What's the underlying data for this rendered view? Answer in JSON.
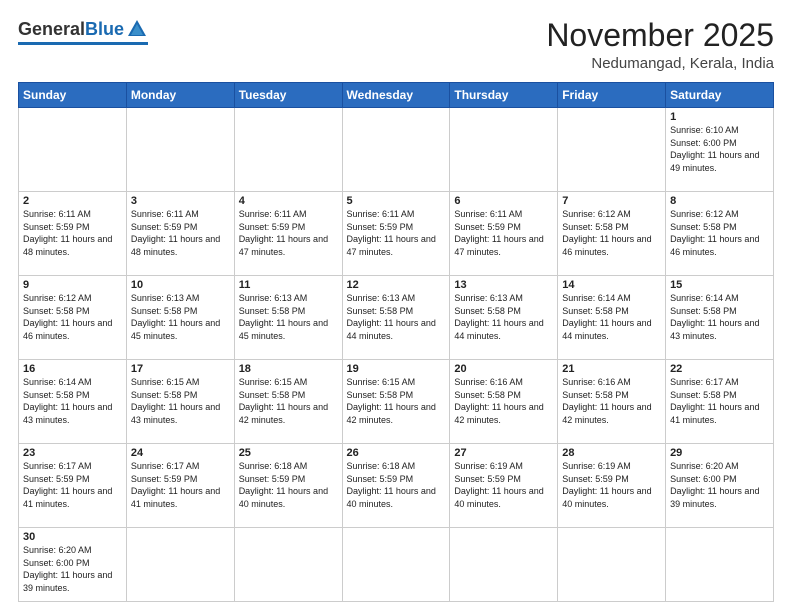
{
  "header": {
    "logo_general": "General",
    "logo_blue": "Blue",
    "month_title": "November 2025",
    "location": "Nedumangad, Kerala, India"
  },
  "days_of_week": [
    "Sunday",
    "Monday",
    "Tuesday",
    "Wednesday",
    "Thursday",
    "Friday",
    "Saturday"
  ],
  "weeks": [
    [
      {
        "day": "",
        "sunrise": "",
        "sunset": "",
        "daylight": "",
        "empty": true
      },
      {
        "day": "",
        "sunrise": "",
        "sunset": "",
        "daylight": "",
        "empty": true
      },
      {
        "day": "",
        "sunrise": "",
        "sunset": "",
        "daylight": "",
        "empty": true
      },
      {
        "day": "",
        "sunrise": "",
        "sunset": "",
        "daylight": "",
        "empty": true
      },
      {
        "day": "",
        "sunrise": "",
        "sunset": "",
        "daylight": "",
        "empty": true
      },
      {
        "day": "",
        "sunrise": "",
        "sunset": "",
        "daylight": "",
        "empty": true
      },
      {
        "day": "1",
        "sunrise": "Sunrise: 6:10 AM",
        "sunset": "Sunset: 6:00 PM",
        "daylight": "Daylight: 11 hours and 49 minutes.",
        "empty": false
      }
    ],
    [
      {
        "day": "2",
        "sunrise": "Sunrise: 6:11 AM",
        "sunset": "Sunset: 5:59 PM",
        "daylight": "Daylight: 11 hours and 48 minutes.",
        "empty": false
      },
      {
        "day": "3",
        "sunrise": "Sunrise: 6:11 AM",
        "sunset": "Sunset: 5:59 PM",
        "daylight": "Daylight: 11 hours and 48 minutes.",
        "empty": false
      },
      {
        "day": "4",
        "sunrise": "Sunrise: 6:11 AM",
        "sunset": "Sunset: 5:59 PM",
        "daylight": "Daylight: 11 hours and 47 minutes.",
        "empty": false
      },
      {
        "day": "5",
        "sunrise": "Sunrise: 6:11 AM",
        "sunset": "Sunset: 5:59 PM",
        "daylight": "Daylight: 11 hours and 47 minutes.",
        "empty": false
      },
      {
        "day": "6",
        "sunrise": "Sunrise: 6:11 AM",
        "sunset": "Sunset: 5:59 PM",
        "daylight": "Daylight: 11 hours and 47 minutes.",
        "empty": false
      },
      {
        "day": "7",
        "sunrise": "Sunrise: 6:12 AM",
        "sunset": "Sunset: 5:58 PM",
        "daylight": "Daylight: 11 hours and 46 minutes.",
        "empty": false
      },
      {
        "day": "8",
        "sunrise": "Sunrise: 6:12 AM",
        "sunset": "Sunset: 5:58 PM",
        "daylight": "Daylight: 11 hours and 46 minutes.",
        "empty": false
      }
    ],
    [
      {
        "day": "9",
        "sunrise": "Sunrise: 6:12 AM",
        "sunset": "Sunset: 5:58 PM",
        "daylight": "Daylight: 11 hours and 46 minutes.",
        "empty": false
      },
      {
        "day": "10",
        "sunrise": "Sunrise: 6:13 AM",
        "sunset": "Sunset: 5:58 PM",
        "daylight": "Daylight: 11 hours and 45 minutes.",
        "empty": false
      },
      {
        "day": "11",
        "sunrise": "Sunrise: 6:13 AM",
        "sunset": "Sunset: 5:58 PM",
        "daylight": "Daylight: 11 hours and 45 minutes.",
        "empty": false
      },
      {
        "day": "12",
        "sunrise": "Sunrise: 6:13 AM",
        "sunset": "Sunset: 5:58 PM",
        "daylight": "Daylight: 11 hours and 44 minutes.",
        "empty": false
      },
      {
        "day": "13",
        "sunrise": "Sunrise: 6:13 AM",
        "sunset": "Sunset: 5:58 PM",
        "daylight": "Daylight: 11 hours and 44 minutes.",
        "empty": false
      },
      {
        "day": "14",
        "sunrise": "Sunrise: 6:14 AM",
        "sunset": "Sunset: 5:58 PM",
        "daylight": "Daylight: 11 hours and 44 minutes.",
        "empty": false
      },
      {
        "day": "15",
        "sunrise": "Sunrise: 6:14 AM",
        "sunset": "Sunset: 5:58 PM",
        "daylight": "Daylight: 11 hours and 43 minutes.",
        "empty": false
      }
    ],
    [
      {
        "day": "16",
        "sunrise": "Sunrise: 6:14 AM",
        "sunset": "Sunset: 5:58 PM",
        "daylight": "Daylight: 11 hours and 43 minutes.",
        "empty": false
      },
      {
        "day": "17",
        "sunrise": "Sunrise: 6:15 AM",
        "sunset": "Sunset: 5:58 PM",
        "daylight": "Daylight: 11 hours and 43 minutes.",
        "empty": false
      },
      {
        "day": "18",
        "sunrise": "Sunrise: 6:15 AM",
        "sunset": "Sunset: 5:58 PM",
        "daylight": "Daylight: 11 hours and 42 minutes.",
        "empty": false
      },
      {
        "day": "19",
        "sunrise": "Sunrise: 6:15 AM",
        "sunset": "Sunset: 5:58 PM",
        "daylight": "Daylight: 11 hours and 42 minutes.",
        "empty": false
      },
      {
        "day": "20",
        "sunrise": "Sunrise: 6:16 AM",
        "sunset": "Sunset: 5:58 PM",
        "daylight": "Daylight: 11 hours and 42 minutes.",
        "empty": false
      },
      {
        "day": "21",
        "sunrise": "Sunrise: 6:16 AM",
        "sunset": "Sunset: 5:58 PM",
        "daylight": "Daylight: 11 hours and 42 minutes.",
        "empty": false
      },
      {
        "day": "22",
        "sunrise": "Sunrise: 6:17 AM",
        "sunset": "Sunset: 5:58 PM",
        "daylight": "Daylight: 11 hours and 41 minutes.",
        "empty": false
      }
    ],
    [
      {
        "day": "23",
        "sunrise": "Sunrise: 6:17 AM",
        "sunset": "Sunset: 5:59 PM",
        "daylight": "Daylight: 11 hours and 41 minutes.",
        "empty": false
      },
      {
        "day": "24",
        "sunrise": "Sunrise: 6:17 AM",
        "sunset": "Sunset: 5:59 PM",
        "daylight": "Daylight: 11 hours and 41 minutes.",
        "empty": false
      },
      {
        "day": "25",
        "sunrise": "Sunrise: 6:18 AM",
        "sunset": "Sunset: 5:59 PM",
        "daylight": "Daylight: 11 hours and 40 minutes.",
        "empty": false
      },
      {
        "day": "26",
        "sunrise": "Sunrise: 6:18 AM",
        "sunset": "Sunset: 5:59 PM",
        "daylight": "Daylight: 11 hours and 40 minutes.",
        "empty": false
      },
      {
        "day": "27",
        "sunrise": "Sunrise: 6:19 AM",
        "sunset": "Sunset: 5:59 PM",
        "daylight": "Daylight: 11 hours and 40 minutes.",
        "empty": false
      },
      {
        "day": "28",
        "sunrise": "Sunrise: 6:19 AM",
        "sunset": "Sunset: 5:59 PM",
        "daylight": "Daylight: 11 hours and 40 minutes.",
        "empty": false
      },
      {
        "day": "29",
        "sunrise": "Sunrise: 6:20 AM",
        "sunset": "Sunset: 6:00 PM",
        "daylight": "Daylight: 11 hours and 39 minutes.",
        "empty": false
      }
    ],
    [
      {
        "day": "30",
        "sunrise": "Sunrise: 6:20 AM",
        "sunset": "Sunset: 6:00 PM",
        "daylight": "Daylight: 11 hours and 39 minutes.",
        "empty": false
      },
      {
        "day": "",
        "sunrise": "",
        "sunset": "",
        "daylight": "",
        "empty": true
      },
      {
        "day": "",
        "sunrise": "",
        "sunset": "",
        "daylight": "",
        "empty": true
      },
      {
        "day": "",
        "sunrise": "",
        "sunset": "",
        "daylight": "",
        "empty": true
      },
      {
        "day": "",
        "sunrise": "",
        "sunset": "",
        "daylight": "",
        "empty": true
      },
      {
        "day": "",
        "sunrise": "",
        "sunset": "",
        "daylight": "",
        "empty": true
      },
      {
        "day": "",
        "sunrise": "",
        "sunset": "",
        "daylight": "",
        "empty": true
      }
    ]
  ]
}
